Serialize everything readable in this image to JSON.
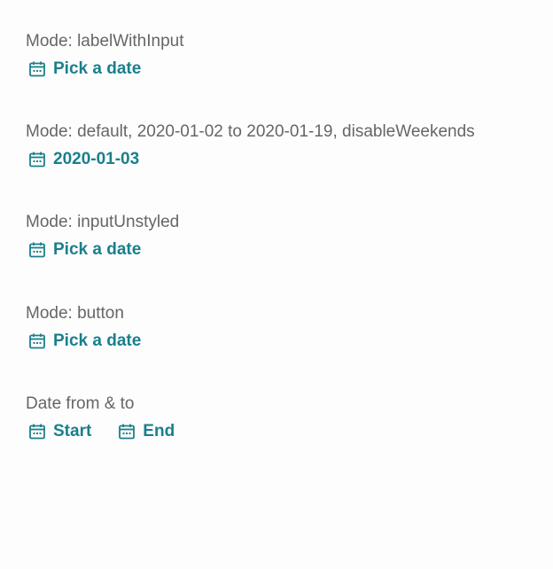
{
  "sections": [
    {
      "label": "Mode: labelWithInput",
      "pickers": [
        {
          "text": "Pick a date",
          "icon": "calendar-icon"
        }
      ]
    },
    {
      "label": "Mode: default, 2020-01-02 to 2020-01-19, disableWeekends",
      "pickers": [
        {
          "text": "2020-01-03",
          "icon": "calendar-icon"
        }
      ]
    },
    {
      "label": "Mode: inputUnstyled",
      "pickers": [
        {
          "text": "Pick a date",
          "icon": "calendar-icon"
        }
      ]
    },
    {
      "label": "Mode: button",
      "pickers": [
        {
          "text": "Pick a date",
          "icon": "calendar-icon"
        }
      ]
    },
    {
      "label": "Date from & to",
      "pickers": [
        {
          "text": "Start",
          "icon": "calendar-icon"
        },
        {
          "text": "End",
          "icon": "calendar-icon"
        }
      ]
    }
  ],
  "colors": {
    "accent": "#1a7f8c",
    "label": "#666666",
    "background": "#fdfdfd"
  }
}
